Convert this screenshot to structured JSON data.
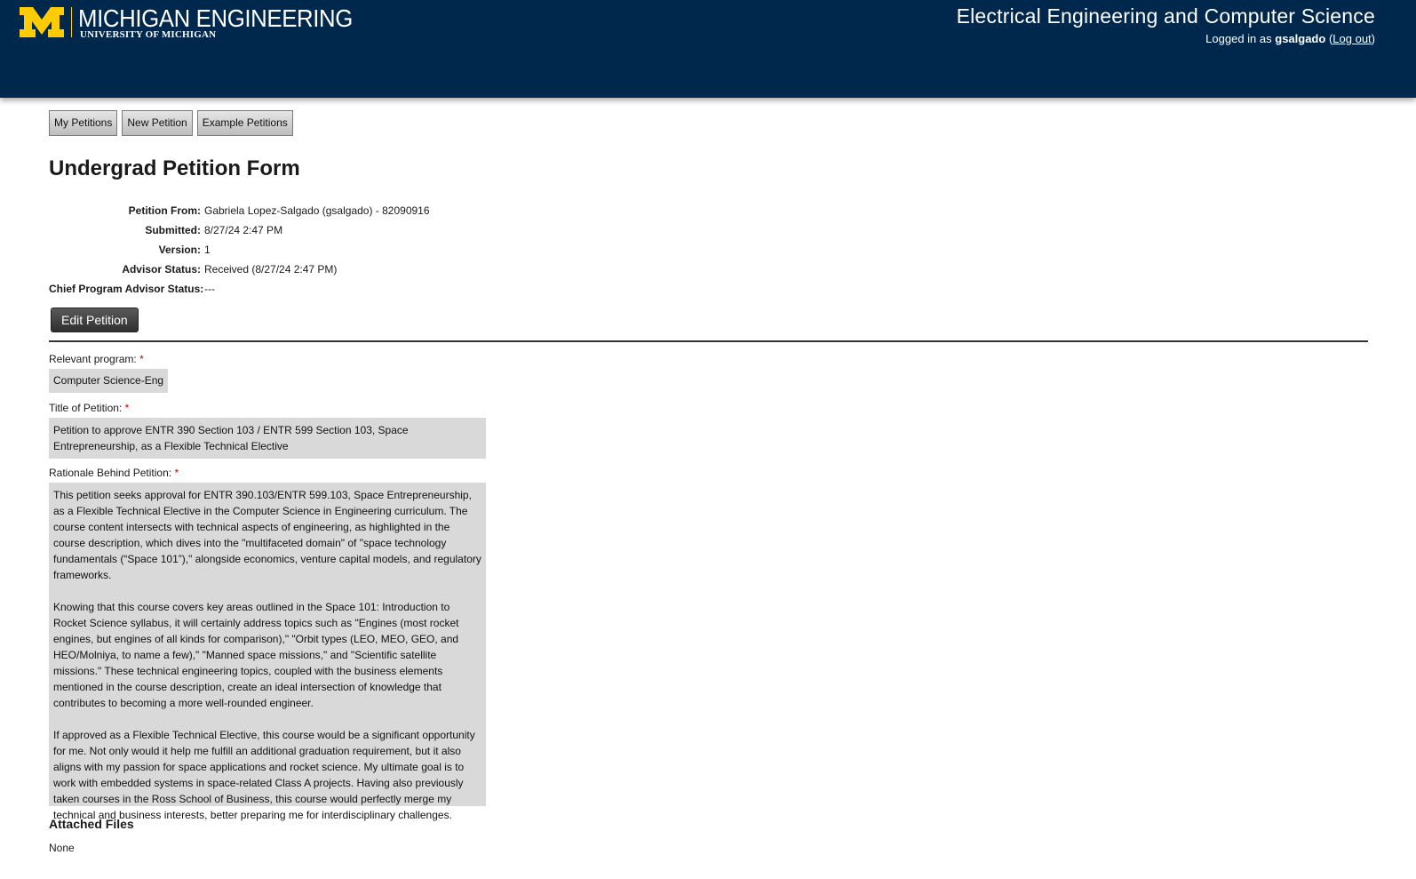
{
  "header": {
    "logo_main": "MICHIGAN ENGINEERING",
    "logo_sub": "UNIVERSITY OF MICHIGAN",
    "dept_title": "Electrical Engineering and Computer Science",
    "logged_in_prefix": "Logged in as",
    "username": "gsalgado",
    "logout_label": "Log out",
    "brand_blue": "#00274c",
    "brand_maize": "#ffcb05"
  },
  "tabs": [
    {
      "label": "My Petitions"
    },
    {
      "label": "New Petition"
    },
    {
      "label": "Example Petitions"
    }
  ],
  "page_title": "Undergrad Petition Form",
  "meta": [
    {
      "label": "Petition From:",
      "value": "Gabriela Lopez-Salgado (gsalgado) - 82090916"
    },
    {
      "label": "Submitted:",
      "value": "8/27/24 2:47 PM"
    },
    {
      "label": "Version:",
      "value": "1"
    },
    {
      "label": "Advisor Status:",
      "value": "Received (8/27/24 2:47 PM)"
    },
    {
      "label": "Chief Program Advisor Status:",
      "value": "---"
    }
  ],
  "edit_label": "Edit Petition",
  "fields": {
    "program": {
      "label": "Relevant program:",
      "required": "*",
      "value": "Computer Science-Eng"
    },
    "title": {
      "label": "Title of Petition:",
      "required": "*",
      "value": "Petition to approve ENTR 390 Section 103 / ENTR 599 Section 103, Space Entrepreneurship, as a Flexible Technical Elective"
    },
    "rationale": {
      "label": "Rationale Behind Petition:",
      "required": "*",
      "paragraphs": [
        "This petition seeks approval for ENTR 390.103/ENTR 599.103, Space Entrepreneurship, as a Flexible Technical Elective in the Computer Science in Engineering curriculum. The course content intersects with technical aspects of engineering, as highlighted in the course description, which dives into the \"multifaceted domain\" of \"space technology fundamentals (“Space 101”),\" alongside economics, venture capital models, and regulatory frameworks.",
        "Knowing that this course covers key areas outlined in the Space 101: Introduction to Rocket Science syllabus, it will certainly address topics such as \"Engines (most rocket engines, but engines of all kinds for comparison),\" \"Orbit types (LEO, MEO, GEO, and HEO/Molniya, to name a few),\" \"Manned space missions,\" and \"Scientific satellite missions.\" These technical engineering topics, coupled with the business elements mentioned in the course description, create an ideal intersection of knowledge that contributes to becoming a more well-rounded engineer.",
        "If approved as a Flexible Technical Elective, this course would be a significant opportunity for me. Not only would it help me fulfill an additional graduation requirement, but it also aligns with my passion for space applications and rocket science. My ultimate goal is to work with embedded systems in space-related Class A projects. Having also previously taken courses in the Ross School of Business, this course would perfectly merge my technical and business interests, better preparing me for interdisciplinary challenges."
      ]
    }
  },
  "attached": {
    "title": "Attached Files",
    "value": "None"
  }
}
